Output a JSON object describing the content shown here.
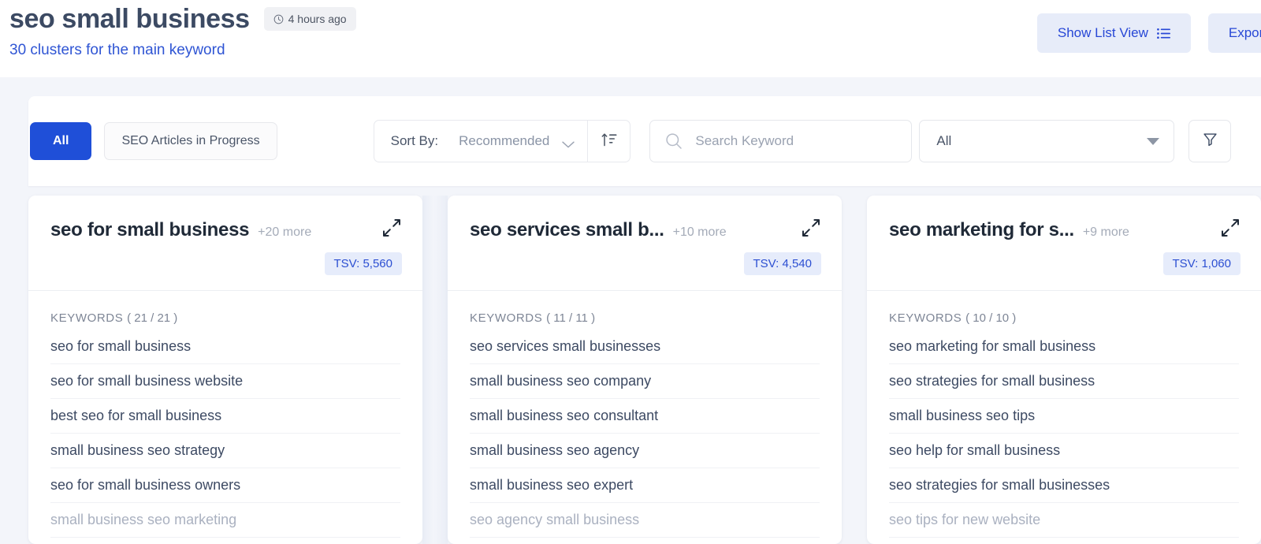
{
  "header": {
    "title": "seo small business",
    "timestamp": "4 hours ago",
    "clock_icon": "clock-icon",
    "subtitle": "30 clusters for the main keyword",
    "actions": [
      {
        "label": "Show List View",
        "icon": "list-icon"
      },
      {
        "label": "Export",
        "icon": ""
      }
    ]
  },
  "filters": {
    "tabs": [
      {
        "label": "All",
        "active": true
      },
      {
        "label": "SEO Articles in Progress",
        "active": false
      }
    ],
    "sort": {
      "label": "Sort By:",
      "value": "Recommended",
      "chevron_icon": "chevron-down-icon",
      "direction_icon": "sort-ascending-icon"
    },
    "search": {
      "placeholder": "Search Keyword",
      "value": "",
      "icon": "search-icon"
    },
    "select": {
      "value": "All",
      "caret_icon": "caret-down-icon"
    },
    "filter_button_icon": "funnel-icon"
  },
  "clusters": [
    {
      "title": "seo for small business",
      "more": "+20 more",
      "tsv": "TSV: 5,560",
      "expand_icon": "expand-icon",
      "keywords_label": "KEYWORDS",
      "keywords_count": "( 21 / 21 )",
      "keywords": [
        "seo for small business",
        "seo for small business website",
        "best seo for small business",
        "small business seo strategy",
        "seo for small business owners",
        "small business seo marketing"
      ]
    },
    {
      "title": "seo services small b...",
      "more": "+10 more",
      "tsv": "TSV: 4,540",
      "expand_icon": "expand-icon",
      "keywords_label": "KEYWORDS",
      "keywords_count": "( 11 / 11 )",
      "keywords": [
        "seo services small businesses",
        "small business seo company",
        "small business seo consultant",
        "small business seo agency",
        "small business seo expert",
        "seo agency small business"
      ]
    },
    {
      "title": "seo marketing for s...",
      "more": "+9 more",
      "tsv": "TSV: 1,060",
      "expand_icon": "expand-icon",
      "keywords_label": "KEYWORDS",
      "keywords_count": "( 10 / 10 )",
      "keywords": [
        "seo marketing for small business",
        "seo strategies for small business",
        "small business seo tips",
        "seo help for small business",
        "seo strategies for small businesses",
        "seo tips for new website"
      ]
    }
  ],
  "colors": {
    "page_bg": "#f3f5fa",
    "accent_blue": "#1f4fd8",
    "link_blue": "#2f55d4",
    "title_navy": "#3c4a63",
    "badge_bg": "#e6ecfb",
    "button_bg": "#e7ecf9"
  }
}
